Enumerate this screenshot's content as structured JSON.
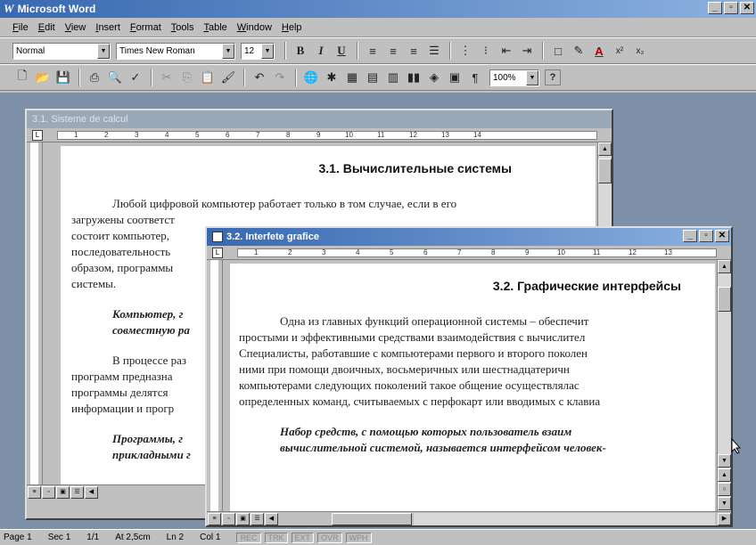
{
  "app": {
    "title": "Microsoft Word",
    "logo": "W",
    "window_buttons": [
      "_",
      "▫",
      "✕"
    ]
  },
  "menu": {
    "items": [
      "File",
      "Edit",
      "View",
      "Insert",
      "Format",
      "Tools",
      "Table",
      "Window",
      "Help"
    ]
  },
  "format_toolbar": {
    "style_value": "Normal",
    "font_value": "Times New Roman",
    "size_value": "12",
    "bold": "B",
    "italic": "I",
    "underline": "U",
    "align_icons": [
      "align-left-icon",
      "center-icon",
      "align-right-icon",
      "justify-icon"
    ],
    "list_icons": [
      "numbering-icon",
      "bullets-icon",
      "decrease-indent-icon",
      "increase-indent-icon"
    ],
    "border_icon": "border-icon",
    "highlight_icon": "highlight-icon",
    "font_color_label": "A",
    "superscript": "x²",
    "subscript": "x₂"
  },
  "standard_toolbar": {
    "zoom_value": "100%",
    "pilcrow": "¶",
    "help_icon": "?"
  },
  "doc1": {
    "title": "3.1. Sisteme de calcul",
    "ruler_numbers": [
      "1",
      "2",
      "3",
      "4",
      "5",
      "6",
      "7",
      "8",
      "9",
      "10",
      "11",
      "12",
      "13",
      "14"
    ],
    "heading": "3.1. Вычислительные системы",
    "para1": [
      "Любой цифровой компьютер работает только в том случае, если в его",
      "загружены соответст",
      "состоит компьютер,",
      "последовательность",
      "образом, программы",
      "системы."
    ],
    "para2": [
      "Компьютер, г",
      "совместную ра"
    ],
    "para3": [
      "В процессе раз",
      "программ предназна",
      "программы делятся",
      "информации и прогр"
    ],
    "para4": [
      "Программы, г",
      "прикладными г"
    ]
  },
  "doc2": {
    "title": "3.2. Interfete grafice",
    "ruler_numbers": [
      "1",
      "2",
      "3",
      "4",
      "5",
      "6",
      "7",
      "8",
      "9",
      "10",
      "11",
      "12",
      "13"
    ],
    "heading": "3.2. Графические интерфейсы",
    "para1": [
      "Одна из главных функций операционной системы – обеспечит",
      "простыми и эффективными средствами взаимодействия с вычислител",
      "Специалисты, работавшие с компьютерами первого и второго поколен",
      "ними при помощи двоичных, восьмеричных или шестнадцатеричн",
      "компьютерами следующих поколений такое общение осуществлялас",
      "определенных команд, считываемых с перфокарт или вводимых с клавиа"
    ],
    "para2": [
      "Набор средств, с помощью которых пользователь взаим",
      "вычислительной системой, называется интерфейсом человек-"
    ]
  },
  "status": {
    "page": "Page 1",
    "sec": "Sec 1",
    "pages": "1/1",
    "at": "At 2,5cm",
    "ln": "Ln 2",
    "col": "Col 1",
    "modes": [
      "REC",
      "TRK",
      "EXT",
      "OVR",
      "WPH"
    ]
  },
  "colors": {
    "titlebar_start": "#3868b0",
    "titlebar_end": "#8db2e0",
    "workspace": "#7d90a8",
    "chrome": "#c0c0c0"
  }
}
